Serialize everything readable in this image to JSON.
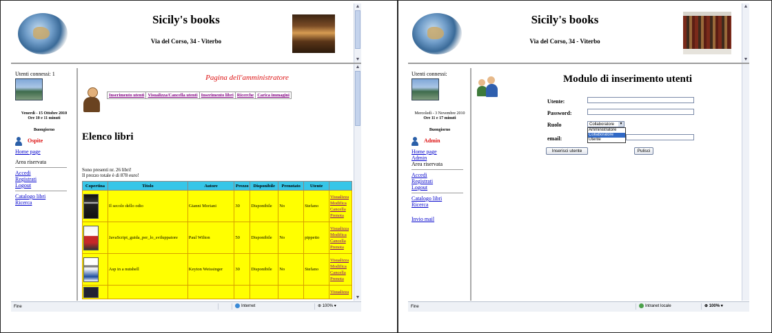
{
  "left": {
    "header": {
      "title": "Sicily's books",
      "address": "Via del Corso, 34 - Viterbo"
    },
    "sidebar": {
      "users_connected": "Utenti connessi: 1",
      "date": "Venerdì - 15 Ottobre 2010",
      "time": "Ore 10 e 11 minuti",
      "greeting": "Buongiorno",
      "user_name": "Ospite",
      "home_link": "Home page",
      "reserved_area": "Area riservata",
      "links1": [
        "Accedi",
        "Registrati",
        "Logout"
      ],
      "links2": [
        "Catalogo libri",
        "Ricerca"
      ]
    },
    "main": {
      "admin_title": "Pagina dell'amministratore",
      "menu": [
        "Inserimento utenti",
        "Visualizza/Cancella utenti",
        "Inserimento libri",
        "Ricerche",
        "Carica immagini"
      ],
      "heading": "Elenco libri",
      "summary1": "Sono presenti nr. 26 libri!",
      "summary2": "Il prezzo totale è di 878 euro!",
      "table": {
        "headers": [
          "Copertina",
          "Titolo",
          "Autore",
          "Prezzo",
          "Disponibile",
          "Prenotato",
          "Utente",
          ""
        ],
        "rows": [
          {
            "title": "Il secolo dello odio",
            "author": "Gianni Moriani",
            "price": "30",
            "available": "Disponibile",
            "reserved": "No",
            "user": "Stefano"
          },
          {
            "title": "JavaScript_guida_per_lo_sviluppatore",
            "author": "Paul Wilton",
            "price": "50",
            "available": "Disponibile",
            "reserved": "No",
            "user": "pippetto"
          },
          {
            "title": "Asp in a nutshell",
            "author": "Keyton Weissinger",
            "price": "30",
            "available": "Disponibile",
            "reserved": "No",
            "user": "Stefano"
          }
        ],
        "actions": [
          "Visualizza",
          "Modifica",
          "Cancella",
          "Prenota"
        ],
        "partial_action": "Visualizza"
      }
    },
    "status": {
      "left": "Fine",
      "zone": "Internet",
      "zoom": "100%"
    }
  },
  "right": {
    "header": {
      "title": "Sicily's books",
      "address": "Via del Corso, 34 - Viterbo"
    },
    "sidebar": {
      "users_connected": "Utenti connessi:",
      "date": "Mercoledì - 3 Novembre 2010",
      "time": "Ore 11 e 17 minuti",
      "greeting": "Buongiorno",
      "user_name": "Admin",
      "links0": [
        "Home page",
        "Admin"
      ],
      "reserved_area": "Area riservata",
      "links1": [
        "Accedi",
        "Registrati",
        "Logout"
      ],
      "links2": [
        "Catalogo libri",
        "Ricerca"
      ],
      "links3": [
        "Invio mail"
      ]
    },
    "main": {
      "form_title": "Modulo di inserimento utenti",
      "labels": {
        "user": "Utente:",
        "password": "Password:",
        "role": "Ruolo",
        "email": "email:"
      },
      "role_selected": "Collaboratore",
      "role_options": [
        "Amministratore",
        "Collaboratore",
        "Utente"
      ],
      "submit": "Inserisci utente",
      "reset": "Pulisci"
    },
    "status": {
      "left": "Fine",
      "zone": "Intranet locale",
      "zoom": "100%"
    }
  },
  "colors": {
    "table_header": "#37c6e8",
    "table_cell": "#ffff00",
    "link": "#0000cc",
    "visited": "#800080",
    "admin_red": "#dd1111"
  }
}
